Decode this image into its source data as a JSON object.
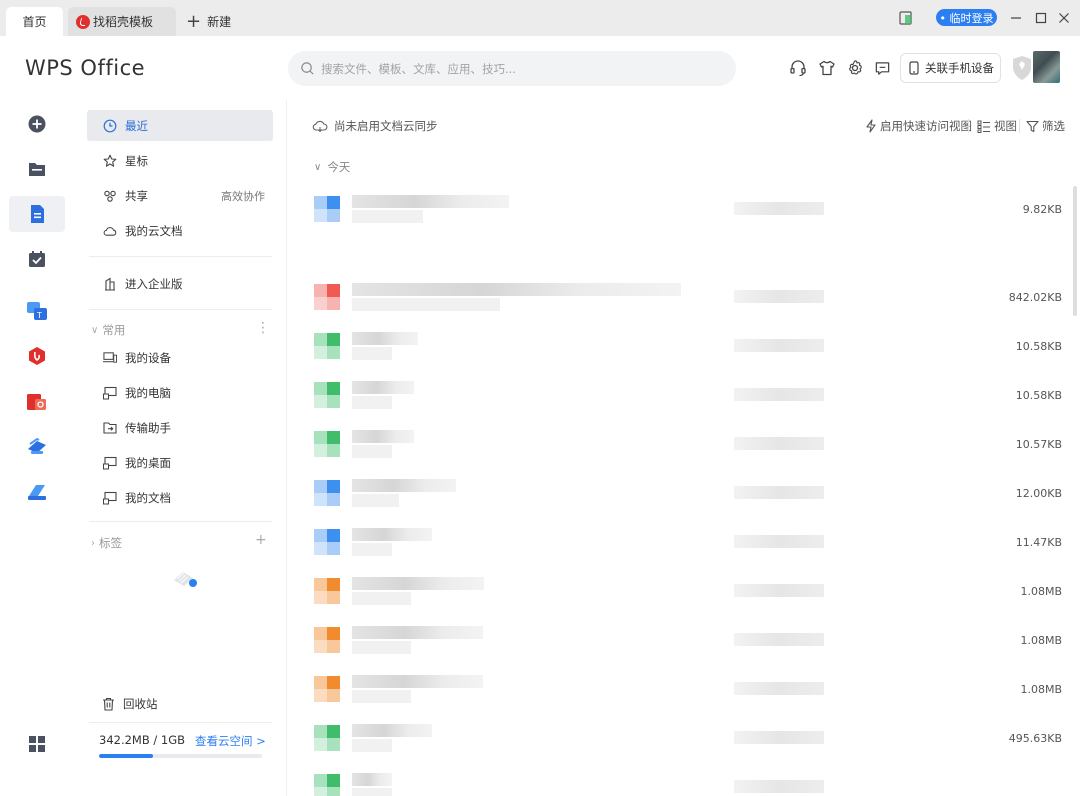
{
  "tabs": {
    "home": "首页",
    "daoke": "找稻壳模板",
    "new": "新建"
  },
  "titlebar": {
    "login": "• 临时登录",
    "minimize_icon": "minimize-icon",
    "maximize_icon": "maximize-icon",
    "close_icon": "close-icon"
  },
  "header": {
    "logo": "WPS Office",
    "search_placeholder": "搜索文件、模板、文库、应用、技巧...",
    "phone_device": "关联手机设备"
  },
  "nav": {
    "recent": "最近",
    "starred": "星标",
    "shared": "共享",
    "shared_tag": "高效协作",
    "cloud_docs": "我的云文档",
    "enterprise": "进入企业版",
    "common_section": "常用",
    "devices": "我的设备",
    "computer": "我的电脑",
    "transfer": "传输助手",
    "desktop": "我的桌面",
    "documents": "我的文档",
    "tags_section": "标签",
    "recycle": "回收站",
    "storage_text": "342.2MB / 1GB",
    "storage_used_fraction": 0.334,
    "storage_link": "查看云空间 >"
  },
  "main": {
    "sync_status": "尚未启用文档云同步",
    "quick_view": "启用快速访问视图",
    "view": "视图",
    "filter": "筛选",
    "group_today": "今天"
  },
  "files": [
    {
      "type": "blue",
      "size": "9.82KB"
    },
    {
      "type": "red",
      "size": "842.02KB"
    },
    {
      "type": "green",
      "size": "10.58KB"
    },
    {
      "type": "green",
      "size": "10.58KB"
    },
    {
      "type": "green",
      "size": "10.57KB"
    },
    {
      "type": "blue",
      "size": "12.00KB"
    },
    {
      "type": "blue",
      "size": "11.47KB"
    },
    {
      "type": "orange",
      "size": "1.08MB"
    },
    {
      "type": "orange",
      "size": "1.08MB"
    },
    {
      "type": "orange",
      "size": "1.08MB"
    },
    {
      "type": "green",
      "size": "495.63KB"
    },
    {
      "type": "green",
      "size": ""
    }
  ],
  "colors": {
    "accent": "#2c7ff2",
    "blue_doc": "#3d8ff0",
    "red_pdf": "#ef5a55",
    "green_sheet": "#3fbd6a",
    "orange_ppt": "#f28a2e"
  }
}
